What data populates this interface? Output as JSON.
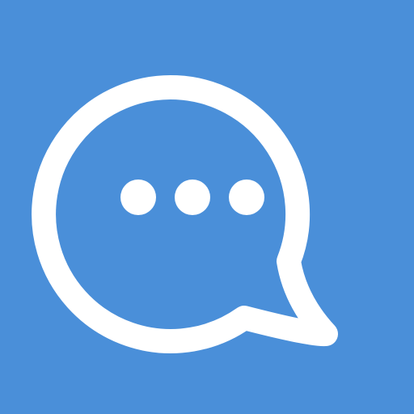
{
  "icon": {
    "name": "chat-bubble-icon",
    "background_color": "#4A8FD9",
    "foreground_color": "#FFFFFF",
    "dot_count": 3
  }
}
